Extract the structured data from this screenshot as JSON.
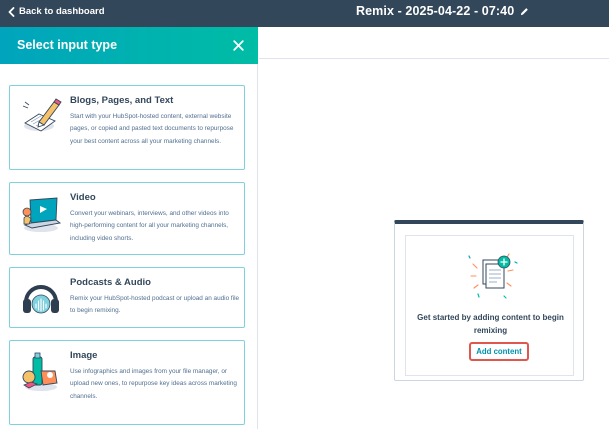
{
  "topbar": {
    "back_label": "Back to dashboard",
    "title": "Remix - 2025-04-22 - 07:40",
    "background": "#33475b"
  },
  "panel": {
    "title": "Select input type",
    "header_colors": [
      "#00a4bd",
      "#00bda5"
    ],
    "cards": [
      {
        "title": "Blogs, Pages, and Text",
        "desc": "Start with your HubSpot-hosted content, external website pages, or copied and pasted text documents to repurpose your best content across all your marketing channels.",
        "icon": "pencil-document-icon"
      },
      {
        "title": "Video",
        "desc": "Convert your webinars, interviews, and other videos into high-performing content for all your marketing channels, including video shorts.",
        "icon": "laptop-video-icon"
      },
      {
        "title": "Podcasts & Audio",
        "desc": "Remix your HubSpot-hosted podcast or upload an audio file to begin remixing.",
        "icon": "headphones-icon"
      },
      {
        "title": "Image",
        "desc": "Use infographics and images from your file manager, or upload new ones, to repurpose key ideas across marketing channels.",
        "icon": "image-objects-icon"
      }
    ]
  },
  "empty_state": {
    "message": "Get started by adding content to begin remixing",
    "button_label": "Add content",
    "icon": "add-documents-icon"
  }
}
